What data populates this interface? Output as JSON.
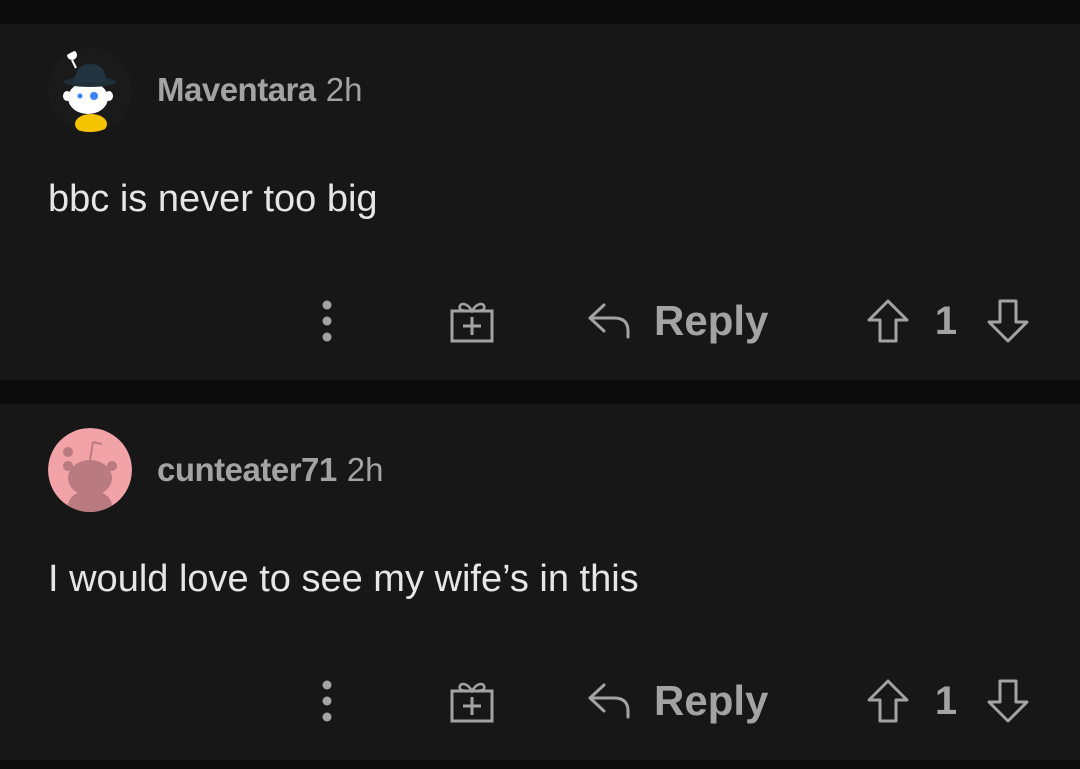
{
  "comments": [
    {
      "username": "Maventara",
      "age": "2h",
      "body": "bbc is never too big",
      "reply_label": "Reply",
      "score": "1",
      "avatar_bg": "#1a1a1a"
    },
    {
      "username": "cunteater71",
      "age": "2h",
      "body": "I would love to see my wife’s in this",
      "reply_label": "Reply",
      "score": "1",
      "avatar_bg": "#f2a3a8"
    }
  ],
  "icons": {
    "more": "more-vertical-icon",
    "award": "gift-award-icon",
    "reply": "reply-arrow-icon",
    "upvote": "upvote-arrow-icon",
    "downvote": "downvote-arrow-icon"
  },
  "colors": {
    "page_bg": "#0b0b0b",
    "card_bg": "#171717",
    "muted_text": "#a3a3a3",
    "body_text": "#e6e6e6"
  }
}
